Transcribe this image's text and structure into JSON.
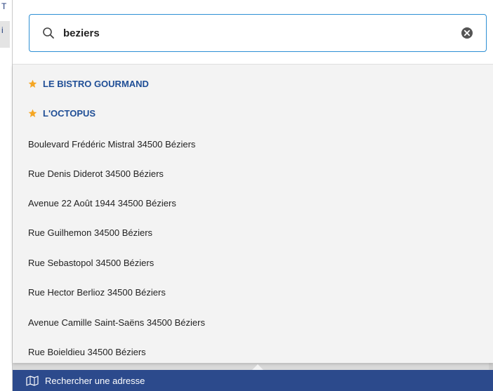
{
  "background": {
    "fragment_top": "T",
    "fragment_mid": "i"
  },
  "search": {
    "value": "beziers",
    "icon": "search-icon",
    "clear_icon": "clear-icon"
  },
  "results": [
    {
      "label": "LE BISTRO GOURMAND",
      "favorite": true
    },
    {
      "label": "L'OCTOPUS",
      "favorite": true
    },
    {
      "label": "Boulevard Frédéric Mistral 34500 Béziers",
      "favorite": false
    },
    {
      "label": "Rue Denis Diderot 34500 Béziers",
      "favorite": false
    },
    {
      "label": "Avenue 22 Août 1944 34500 Béziers",
      "favorite": false
    },
    {
      "label": "Rue Guilhemon 34500 Béziers",
      "favorite": false
    },
    {
      "label": "Rue Sebastopol 34500 Béziers",
      "favorite": false
    },
    {
      "label": "Rue Hector Berlioz 34500 Béziers",
      "favorite": false
    },
    {
      "label": "Avenue Camille Saint-Saëns 34500 Béziers",
      "favorite": false
    },
    {
      "label": "Rue Boieldieu 34500 Béziers",
      "favorite": false
    }
  ],
  "bottom_bar": {
    "label": "Rechercher une adresse",
    "icon": "map-icon"
  },
  "colors": {
    "accent": "#2d8fd4",
    "favorite_text": "#1f4e96",
    "star": "#f5a623",
    "bottom_bar": "#2c4a8c"
  }
}
